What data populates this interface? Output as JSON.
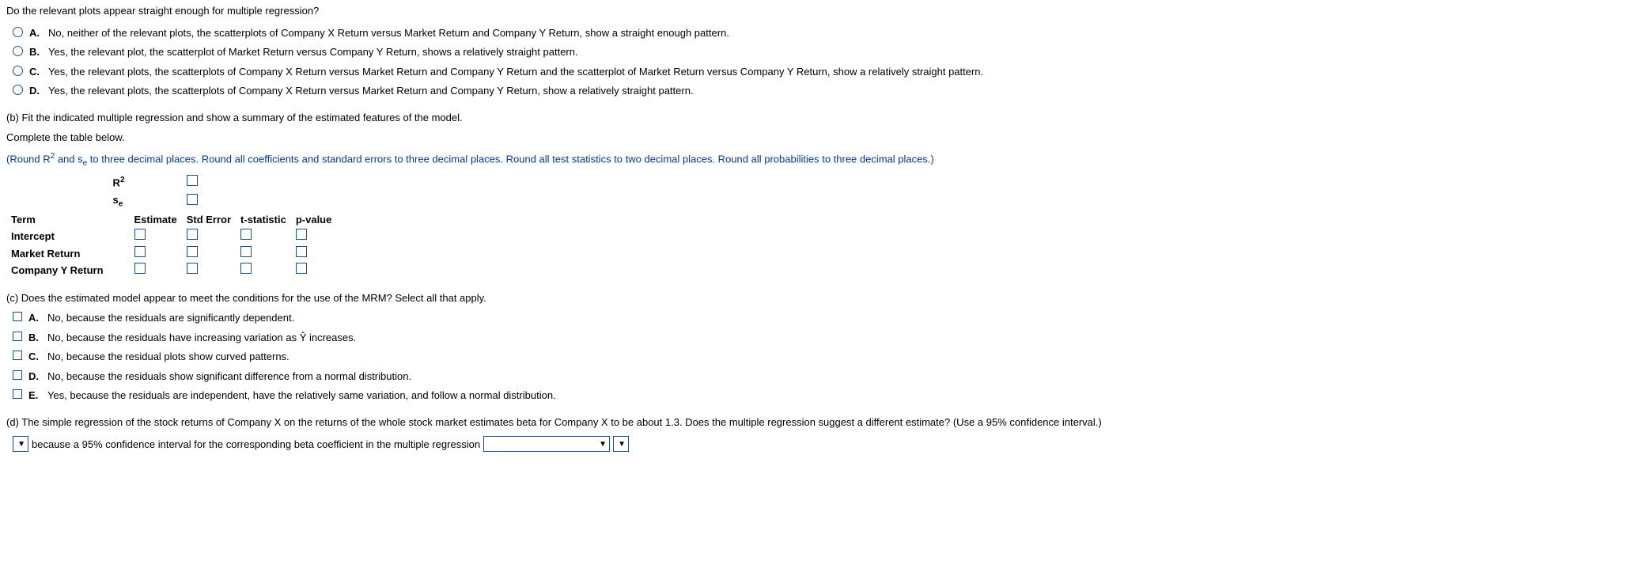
{
  "q1": {
    "prompt": "Do the relevant plots appear straight enough for multiple regression?",
    "options": [
      {
        "letter": "A.",
        "text": "No, neither of the relevant plots, the scatterplots of Company X Return versus Market Return and Company Y Return, show a straight enough pattern."
      },
      {
        "letter": "B.",
        "text": "Yes, the relevant plot, the scatterplot of Market Return versus Company Y Return, shows a relatively straight pattern."
      },
      {
        "letter": "C.",
        "text": "Yes, the relevant plots, the scatterplots of Company X Return versus Market Return and Company Y Return and the scatterplot of Market Return versus Company Y Return, show a relatively straight pattern."
      },
      {
        "letter": "D.",
        "text": "Yes, the relevant plots, the scatterplots of Company X Return versus Market Return and Company Y Return, show a relatively straight pattern."
      }
    ]
  },
  "partB": {
    "heading": "(b) Fit the indicated multiple regression and show a summary of the estimated features of the model.",
    "complete": "Complete the table below.",
    "round_prefix": "(Round R",
    "round_mid": " and s",
    "round_suffix": " to three decimal places. Round all coefficients and standard errors to three decimal places. Round all test statistics to two decimal places. Round all probabilities to three decimal places.)",
    "labels": {
      "r2": "R",
      "se": "s",
      "term": "Term",
      "estimate": "Estimate",
      "stderr": "Std Error",
      "tstat": "t-statistic",
      "pval": "p-value",
      "intercept": "Intercept",
      "market": "Market Return",
      "companyY": "Company Y Return"
    }
  },
  "partC": {
    "prompt": "(c) Does the estimated model appear to meet the conditions for the use of the MRM? Select all that apply.",
    "options": [
      {
        "letter": "A.",
        "text": "No, because the residuals are significantly dependent."
      },
      {
        "letter": "B.",
        "text_before": "No, because the residuals have increasing variation as ",
        "text_after": " increases."
      },
      {
        "letter": "C.",
        "text": "No, because the residual plots show curved patterns."
      },
      {
        "letter": "D.",
        "text": "No, because the residuals show significant difference from a normal distribution."
      },
      {
        "letter": "E.",
        "text": "Yes, because the residuals are independent, have the relatively same variation, and follow a normal distribution."
      }
    ]
  },
  "partD": {
    "prompt": "(d) The simple regression of the stock returns of Company X on the returns of the whole stock market estimates beta for Company X to be about 1.3. Does the multiple regression suggest a different estimate? (Use a 95% confidence interval.)",
    "sentence": "because a 95% confidence interval for the corresponding beta coefficient in the multiple regression"
  }
}
